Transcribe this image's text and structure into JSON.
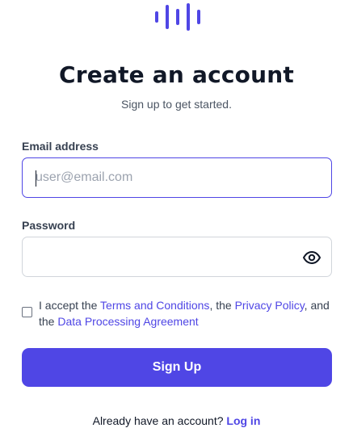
{
  "brand": {
    "accent_color": "#4f46e5",
    "logo_icon": "waveform-logo-icon"
  },
  "header": {
    "title": "Create an account",
    "subtitle": "Sign up to get started."
  },
  "form": {
    "email": {
      "label": "Email address",
      "value": "",
      "placeholder": "user@email.com"
    },
    "password": {
      "label": "Password",
      "value": "",
      "toggle_icon": "eye-icon"
    },
    "terms": {
      "checked": false,
      "prefix": "I accept the",
      "terms_link": "Terms and Conditions",
      "sep1": ", the",
      "privacy_link": "Privacy Policy",
      "sep2": ", and the",
      "dpa_link": "Data Processing Agreement"
    },
    "submit_label": "Sign Up"
  },
  "footer": {
    "prompt": "Already have an account?",
    "login_link": "Log in"
  }
}
